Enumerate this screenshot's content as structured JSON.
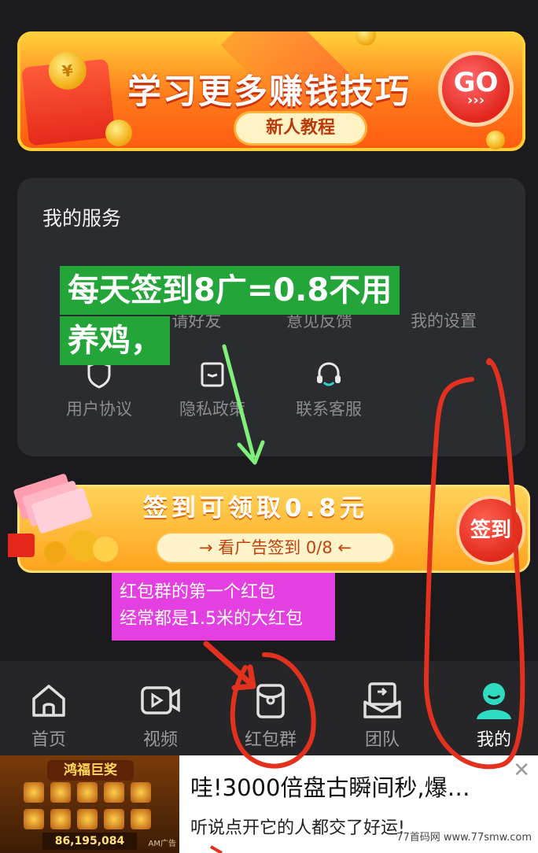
{
  "banner": {
    "title": "学习更多赚钱技巧",
    "subtitle": "新人教程",
    "go_label": "GO",
    "go_arrows": "›››",
    "envelope_mark": "¥"
  },
  "services": {
    "title": "我的服务",
    "row1": [
      "请好友",
      "意见反馈",
      "我的设置"
    ],
    "row2": [
      "用户协议",
      "隐私政策",
      "联系客服"
    ]
  },
  "green_note": {
    "line1": "每天签到8广=0.8不用",
    "line2": "养鸡，"
  },
  "sign_banner": {
    "title": "签到可领取0.8元",
    "subtitle": "→ 看广告签到 0/8 ←",
    "button": "签到"
  },
  "pink_note": {
    "line1": "红包群的第一个红包",
    "line2": "经常都是1.5米的大红包"
  },
  "nav": {
    "items": [
      {
        "label": "首页",
        "icon": "home-icon",
        "active": false
      },
      {
        "label": "视频",
        "icon": "video-icon",
        "active": false
      },
      {
        "label": "红包群",
        "icon": "red-packet-icon",
        "active": false
      },
      {
        "label": "团队",
        "icon": "team-icon",
        "active": false
      },
      {
        "label": "我的",
        "icon": "profile-icon",
        "active": true
      }
    ]
  },
  "ad": {
    "image_title": "鸿福巨奖",
    "image_number": "86,195,084",
    "image_tag": "AM广告",
    "title": "哇!3000倍盘古瞬间秒,爆…",
    "description": "听说点开它的人都交了好运!",
    "close": "✕"
  },
  "watermark": "77首码网 www.77smw.com",
  "colors": {
    "background": "#1b1b1d",
    "card": "#2b2c30",
    "green_overlay": "#23a53a",
    "pink_overlay": "#e43fe0",
    "annotation_red": "#e2321f",
    "annotation_green_arrow": "#7ff07a"
  }
}
